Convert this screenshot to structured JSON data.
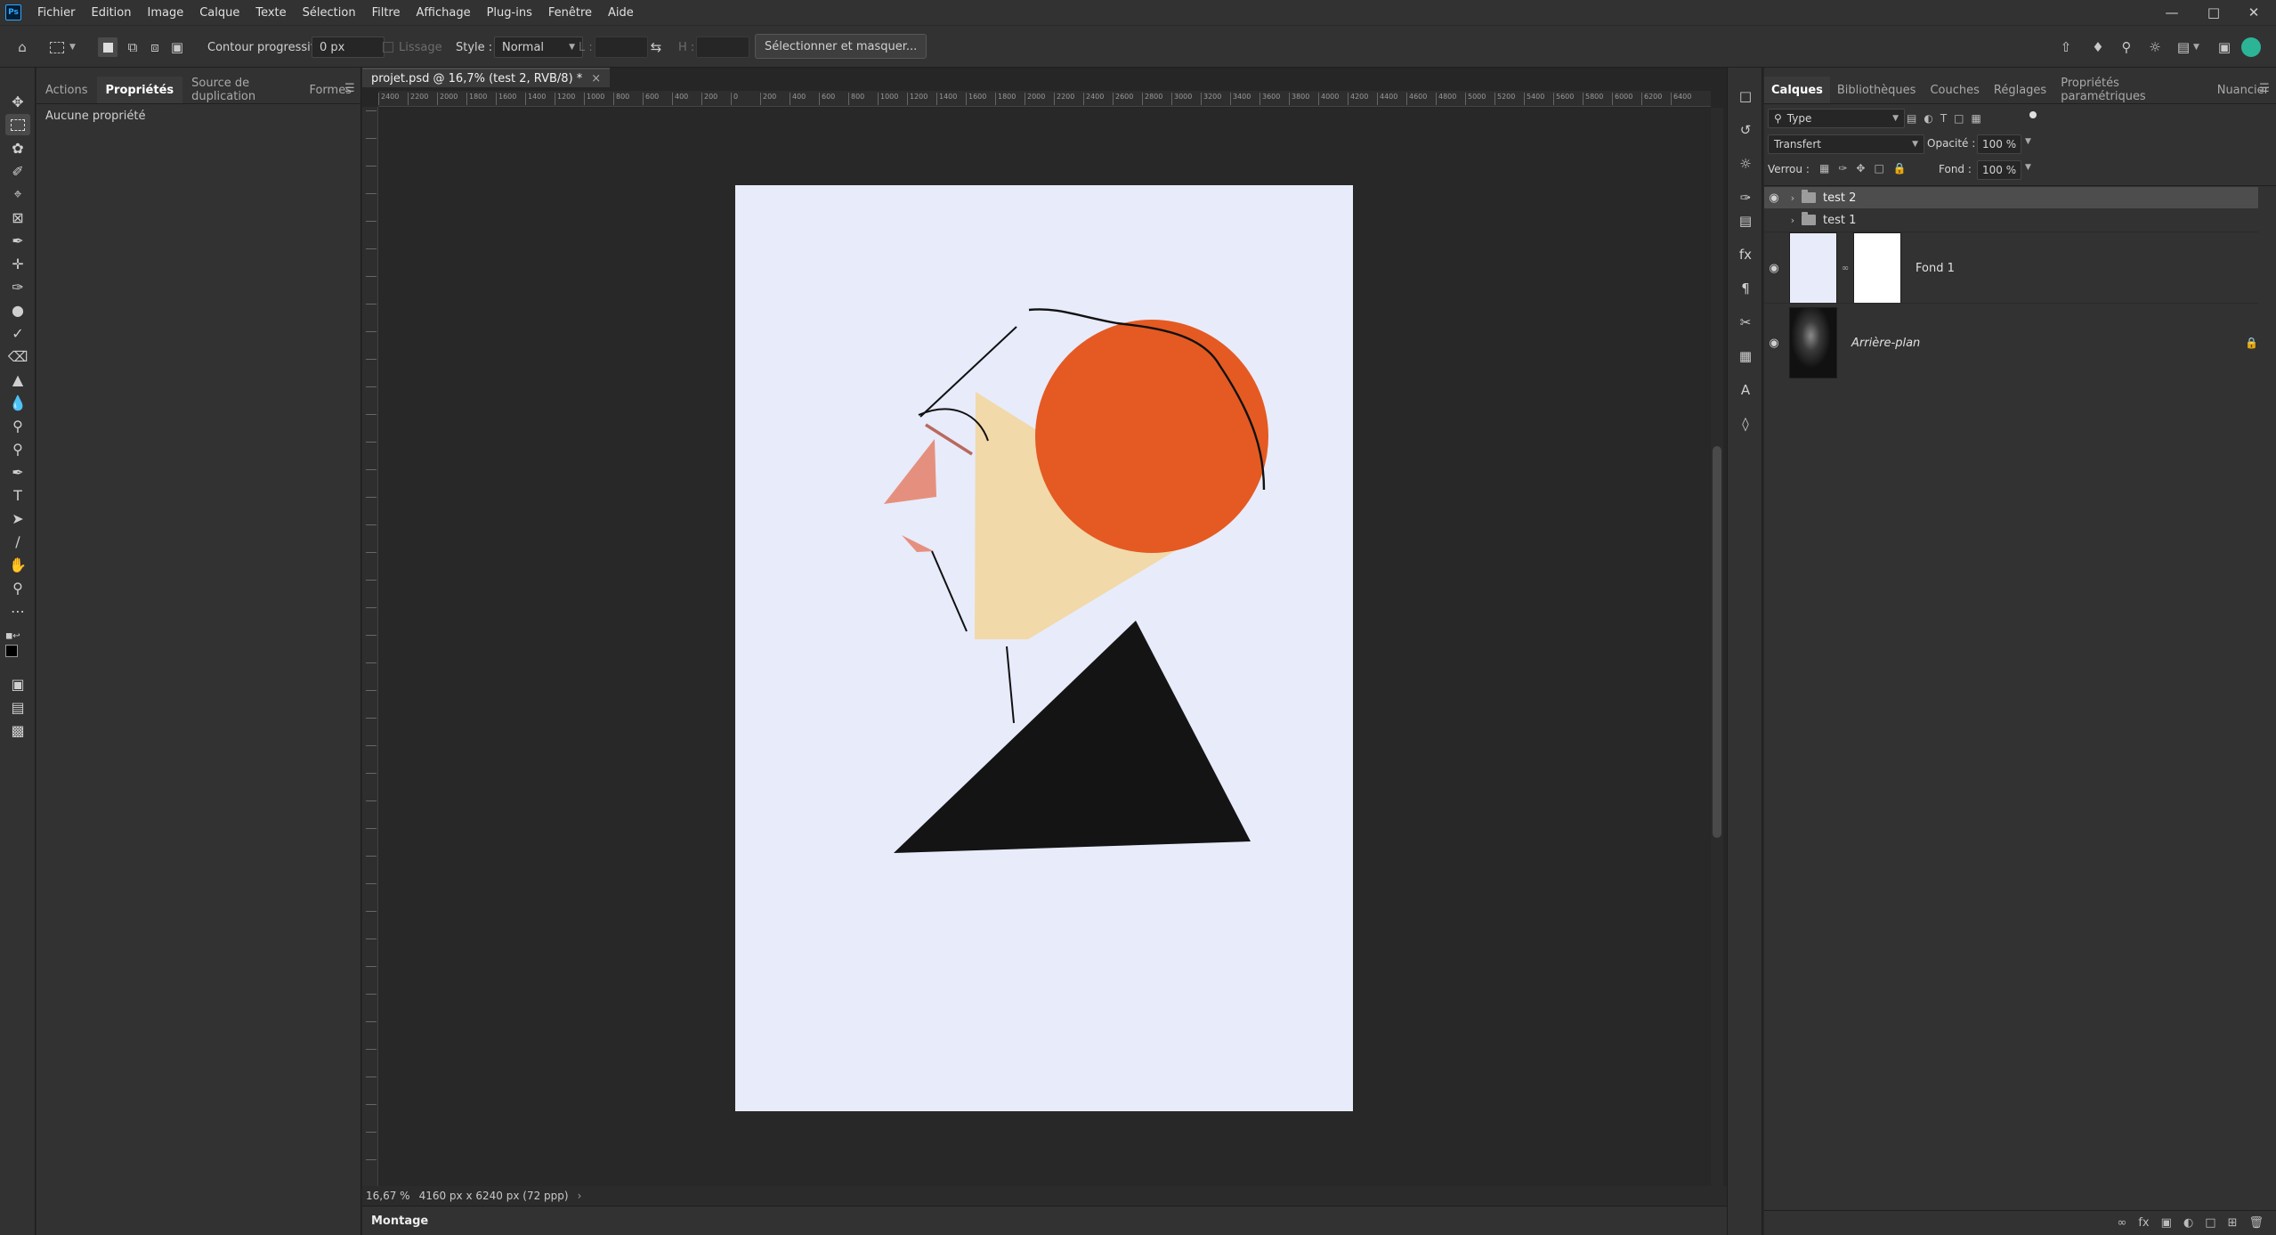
{
  "menubar": {
    "logo": "Ps",
    "items": [
      "Fichier",
      "Edition",
      "Image",
      "Calque",
      "Texte",
      "Sélection",
      "Filtre",
      "Affichage",
      "Plug-ins",
      "Fenêtre",
      "Aide"
    ]
  },
  "optionsbar": {
    "feather_label": "Contour progressif :",
    "feather_value": "0 px",
    "smoothing_label": "Lissage",
    "style_label": "Style :",
    "style_value": "Normal",
    "width_label": "L :",
    "height_label": "H :",
    "select_mask_button": "Sélectionner et masquer..."
  },
  "left_panel": {
    "tabs": [
      "Actions",
      "Propriétés",
      "Source de duplication",
      "Formes"
    ],
    "active_tab": "Propriétés",
    "empty_text": "Aucune propriété"
  },
  "document": {
    "tab_title": "projet.psd @ 16,7% (test 2, RVB/8) *",
    "ruler_labels": [
      "2400",
      "2200",
      "2000",
      "1800",
      "1600",
      "1400",
      "1200",
      "1000",
      "800",
      "600",
      "400",
      "200",
      "0",
      "200",
      "400",
      "600",
      "800",
      "1000",
      "1200",
      "1400",
      "1600",
      "1800",
      "2000",
      "2200",
      "2400",
      "2600",
      "2800",
      "3000",
      "3200",
      "3400",
      "3600",
      "3800",
      "4000",
      "4200",
      "4400",
      "4600",
      "4800",
      "5000",
      "5200",
      "5400",
      "5600",
      "5800",
      "6000",
      "6200",
      "6400"
    ],
    "zoom": "16,67 %",
    "dimensions": "4160 px x 6240 px (72 ppp)",
    "bottom_tab": "Montage",
    "colors": {
      "paper": "#e8ebfa",
      "circle": "#e45a22",
      "beam": "#f1d9a9",
      "nose": "#e5907e",
      "triangle": "#141414",
      "line": "#111111"
    }
  },
  "layers_panel": {
    "tabs": [
      "Calques",
      "Bibliothèques",
      "Couches",
      "Réglages",
      "Propriétés paramétriques",
      "Nuancier"
    ],
    "active_tab": "Calques",
    "filter_value": "Type",
    "blend_mode": "Transfert",
    "opacity_label": "Opacité :",
    "opacity_value": "100 %",
    "lock_label": "Verrou :",
    "fill_label": "Fond :",
    "fill_value": "100 %",
    "layers": [
      {
        "name": "test 2",
        "kind": "group",
        "visible": true,
        "selected": true
      },
      {
        "name": "test 1",
        "kind": "group",
        "visible": false,
        "selected": false
      },
      {
        "name": "Fond 1",
        "kind": "fill",
        "visible": true,
        "selected": false
      },
      {
        "name": "Arrière-plan",
        "kind": "background",
        "visible": true,
        "selected": false,
        "locked": true
      }
    ]
  }
}
